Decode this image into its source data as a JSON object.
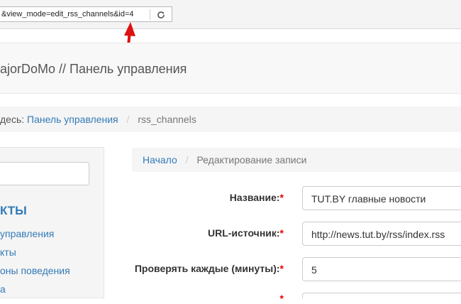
{
  "browser": {
    "url": "&view_mode=edit_rss_channels&id=4",
    "reload_icon": "reload-icon"
  },
  "navbar": {
    "brand": "ajorDoMo // Панель управления"
  },
  "top_breadcrumb": {
    "prefix": "десь:",
    "home_link": "Панель управления",
    "current": "rss_channels"
  },
  "sidebar": {
    "title": "КТЫ",
    "items": [
      {
        "label": "управления"
      },
      {
        "label": "кты"
      },
      {
        "label": "оны поведения"
      },
      {
        "label": "а"
      }
    ]
  },
  "main_breadcrumb": {
    "home_link": "Начало",
    "current": "Редактирование записи"
  },
  "form": {
    "fields": [
      {
        "label": "Название:",
        "required_mark": "*",
        "value": "TUT.BY главные новости"
      },
      {
        "label": "URL-источник:",
        "required_mark": "*",
        "value": "http://news.tut.by/rss/index.rss"
      },
      {
        "label": "Проверять каждые (минуты):",
        "required_mark": "*",
        "value": "5"
      },
      {
        "label": "",
        "required_mark": "*",
        "value": ""
      }
    ]
  },
  "colors": {
    "link": "#337ab7",
    "required": "#ee0000",
    "annotation_arrow": "#dd1111"
  }
}
